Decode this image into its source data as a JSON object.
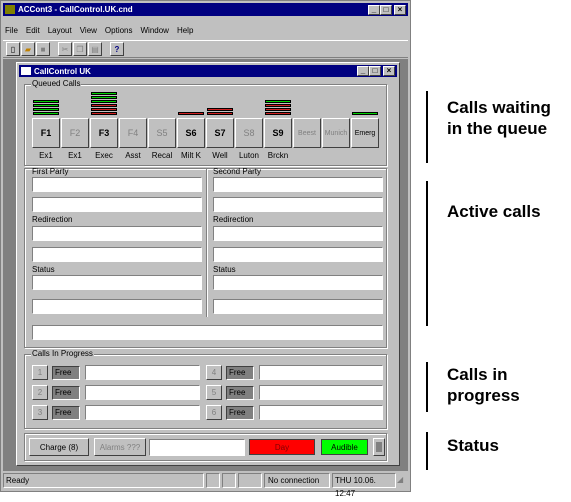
{
  "app": {
    "title": "ACCont3 - CallControl.UK.cnd",
    "menu": [
      "File",
      "Edit",
      "Layout",
      "View",
      "Options",
      "Window",
      "Help"
    ]
  },
  "child": {
    "title": "CallControl UK"
  },
  "queued": {
    "label": "Queued Calls",
    "buttons": [
      {
        "key": "F1",
        "sub": "Ex1",
        "enabled": true,
        "bars": [
          "green",
          "green",
          "green",
          "green"
        ]
      },
      {
        "key": "F2",
        "sub": "Ex1",
        "enabled": false,
        "bars": []
      },
      {
        "key": "F3",
        "sub": "Exec",
        "enabled": true,
        "bars": [
          "green",
          "green",
          "green",
          "red",
          "red",
          "red"
        ]
      },
      {
        "key": "F4",
        "sub": "Asst",
        "enabled": false,
        "bars": []
      },
      {
        "key": "S5",
        "sub": "Recal",
        "enabled": false,
        "bars": []
      },
      {
        "key": "S6",
        "sub": "Milt K",
        "enabled": true,
        "bars": [
          "red"
        ]
      },
      {
        "key": "S7",
        "sub": "Well",
        "enabled": true,
        "bars": [
          "red",
          "red"
        ]
      },
      {
        "key": "S8",
        "sub": "Luton",
        "enabled": false,
        "bars": []
      },
      {
        "key": "S9",
        "sub": "Brckn",
        "enabled": true,
        "bars": [
          "green",
          "red",
          "red",
          "red"
        ]
      },
      {
        "key": "Beest",
        "sub": "",
        "enabled": false,
        "bars": []
      },
      {
        "key": "Munich",
        "sub": "",
        "enabled": false,
        "bars": []
      },
      {
        "key": "Emerg",
        "sub": "",
        "enabled": true,
        "bars": [
          "green"
        ]
      }
    ]
  },
  "active": {
    "first_party": "First Party",
    "second_party": "Second Party",
    "redirection": "Redirection",
    "status": "Status"
  },
  "cip": {
    "label": "Calls In Progress",
    "rows": [
      {
        "num": "1",
        "state": "Free"
      },
      {
        "num": "2",
        "state": "Free"
      },
      {
        "num": "3",
        "state": "Free"
      },
      {
        "num": "4",
        "state": "Free"
      },
      {
        "num": "5",
        "state": "Free"
      },
      {
        "num": "6",
        "state": "Free"
      }
    ]
  },
  "statusbox": {
    "charge": "Charge (8)",
    "alarms": "Alarms ???",
    "day": "Day",
    "audible": "Audible",
    "day_color": "#ff0000",
    "audible_color": "#00ff00"
  },
  "statusbar": {
    "ready": "Ready",
    "connection": "No connection",
    "datetime": "THU 10.06. 12:47"
  },
  "annotations": {
    "queue": [
      "Calls waiting",
      "in the queue"
    ],
    "active": "Active calls",
    "progress": [
      "Calls in",
      "progress"
    ],
    "status": "Status"
  }
}
